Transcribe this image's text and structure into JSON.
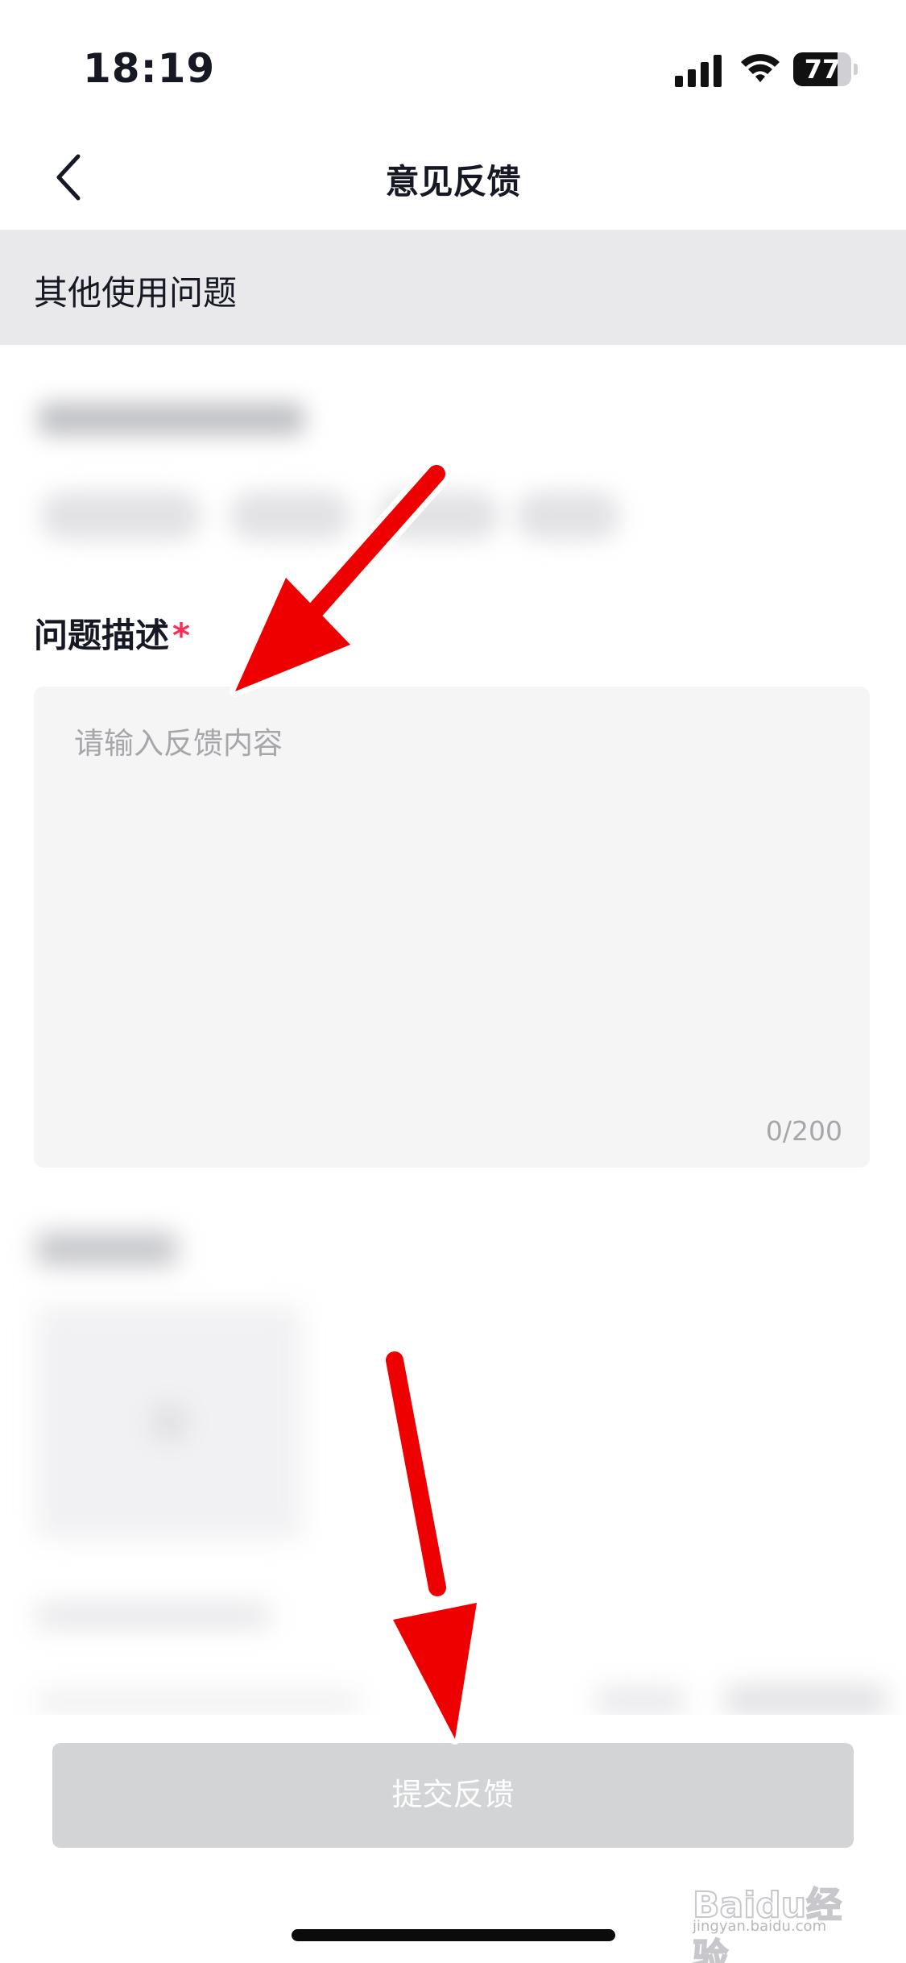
{
  "status_bar": {
    "time": "18:19",
    "battery_percent": "77",
    "battery_level": 0.77,
    "icons": [
      "signal-icon",
      "wifi-icon",
      "battery-icon"
    ]
  },
  "nav": {
    "title": "意见反馈",
    "back_icon": "chevron-left-icon"
  },
  "category": {
    "label": "其他使用问题"
  },
  "description": {
    "label": "问题描述",
    "required_mark": "*",
    "placeholder": "请输入反馈内容",
    "counter": "0/200"
  },
  "submit": {
    "label": "提交反馈"
  },
  "watermark": {
    "text": "Baidu经验",
    "sub": "jingyan.baidu.com"
  },
  "colors": {
    "accent_required": "#fe2c55",
    "annotation_arrow": "#ee0000",
    "submit_disabled": "#d3d4d6",
    "category_bg": "#e9e9ec"
  }
}
